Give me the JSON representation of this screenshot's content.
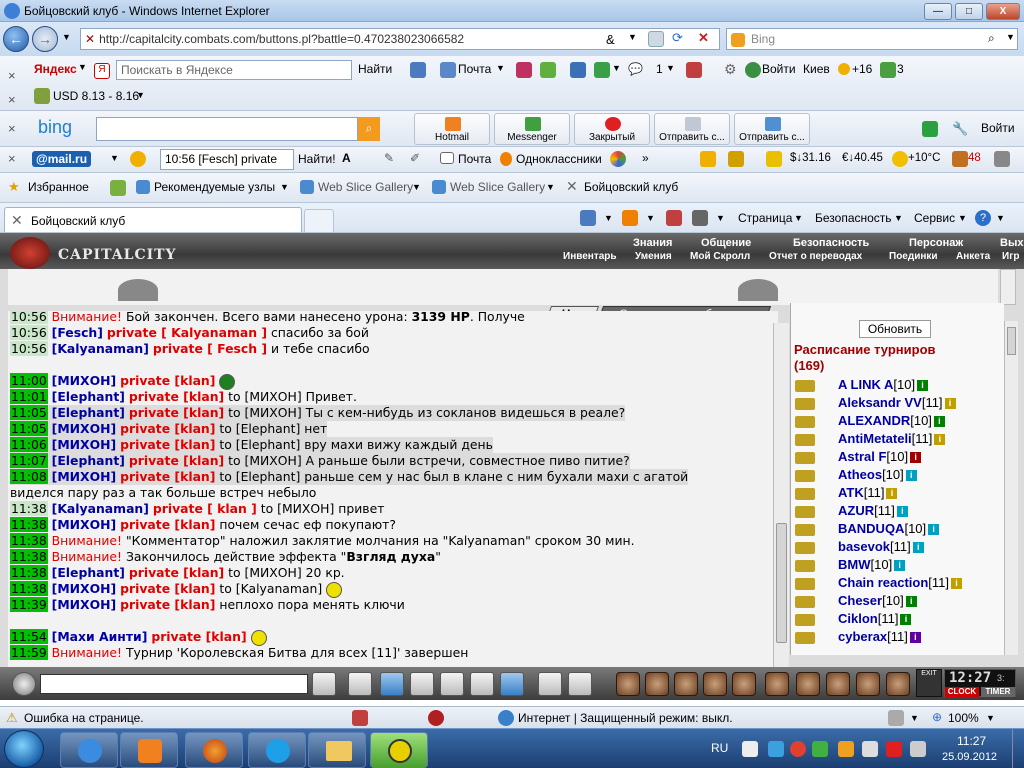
{
  "window": {
    "title": "Бойцовский клуб - Windows Internet Explorer",
    "min": "—",
    "max": "□",
    "close": "X"
  },
  "address": {
    "url": "http://capitalcity.combats.com/buttons.pl?battle=0.470238023066582",
    "search_placeholder": "Bing"
  },
  "yandex": {
    "brand": "Яндекс",
    "search_placeholder": "Поискать в Яндексе",
    "find": "Найти",
    "mail": "Почта",
    "count1": "1",
    "login": "Войти",
    "city": "Киев",
    "temp": "+16",
    "count3": "3",
    "usd": "USD 8.13 - 8.16"
  },
  "bing": {
    "brand": "bing",
    "buttons": [
      "Hotmail",
      "Messenger",
      "Закрытый",
      "Отправить с...",
      "Отправить с..."
    ],
    "login": "Войти"
  },
  "mailru": {
    "brand": "@mail.ru",
    "dropdown": "10:56 [Fesch] private",
    "find": "Найти!",
    "mail": "Почта",
    "ok": "Одноклассники",
    "dollar": "$↓31.16",
    "euro": "€↓40.45",
    "weather": "+10°C",
    "count": "48"
  },
  "favorites": {
    "label": "Избранное",
    "items": [
      "Рекомендуемые узлы",
      "Web Slice Gallery",
      "Web Slice Gallery",
      "Бойцовский клуб"
    ]
  },
  "tab": {
    "label": "Бойцовский клуб"
  },
  "cmd": {
    "page": "Страница",
    "safety": "Безопасность",
    "service": "Сервис"
  },
  "game": {
    "logo": "CAPITALCITY",
    "menu1": [
      "Знания",
      "Общение",
      "Безопасность",
      "Персонаж",
      "Вых"
    ],
    "menu2": [
      "Инвентарь",
      "Умения",
      "Мой Скролл",
      "Отчет о переводах",
      "Поединки",
      "Анкета",
      "Игр"
    ],
    "tabs": [
      "Чат",
      "Системные сообщения"
    ],
    "refresh": "Обновить",
    "tour_title": "Расписание турниров",
    "tour_count": "(169)",
    "clock": "12:27",
    "clock_suffix": "3:",
    "clock_btn": "CLOCK",
    "timer_btn": "TIMER",
    "exit_btn": "EXIT"
  },
  "chat": [
    {
      "time": "10:56",
      "type": "att",
      "att": "Внимание!",
      "text": " Бой закончен. Всего вами нанесено урона: ",
      "bold": "3139 HP",
      "tail": ". Получе"
    },
    {
      "time": "10:56",
      "type": "pm",
      "nick": "[Fesch]",
      "priv": "private [ Kalyanaman ]",
      "text": " спасибо за бой"
    },
    {
      "time": "10:56",
      "type": "pm",
      "nick": "[Kalyanaman]",
      "priv": "private [ Fesch ]",
      "text": " и тебе спасибо"
    },
    {
      "time": "11:00",
      "type": "pm2",
      "nick": "[МИХОН]",
      "priv": "private [klan]",
      "text": ""
    },
    {
      "time": "11:01",
      "type": "pm2",
      "nick": "[Elephant]",
      "priv": "private [klan]",
      "text": " to [МИХОН] Привет."
    },
    {
      "time": "11:05",
      "type": "pm2",
      "nick": "[Elephant]",
      "priv": "private [klan]",
      "text": " to [МИХОН] Ты с кем-нибудь из сокланов видешься в реале?"
    },
    {
      "time": "11:05",
      "type": "pm2",
      "nick": "[МИХОН]",
      "priv": "private [klan]",
      "text": " to [Elephant] нет"
    },
    {
      "time": "11:06",
      "type": "pm2",
      "nick": "[МИХОН]",
      "priv": "private [klan]",
      "text": " to [Elephant] вру махи вижу каждый день"
    },
    {
      "time": "11:07",
      "type": "pm2",
      "nick": "[Elephant]",
      "priv": "private [klan]",
      "text": " to [МИХОН] А раньше были встречи, совместное пиво питие?"
    },
    {
      "time": "11:08",
      "type": "pm2",
      "nick": "[МИХОН]",
      "priv": "private [klan]",
      "text": " to [Elephant] раньше сем у нас был в клане с ним бухали махи с агатой"
    },
    {
      "time": "",
      "type": "cont",
      "text": "виделся пару раз а так больше встреч небыло"
    },
    {
      "time": "11:38",
      "type": "pm",
      "nick": "[Kalyanaman]",
      "priv": "private [ klan ]",
      "text": " to [МИХОН] привет"
    },
    {
      "time": "11:38",
      "type": "pm2",
      "nick": "[МИХОН]",
      "priv": "private [klan]",
      "text": " почем сечас еф покупают?"
    },
    {
      "time": "11:38",
      "type": "att2",
      "att": "Внимание!",
      "text": " \"Комментатор\" наложил заклятие молчания на \"Kalyanaman\" сроком 30 мин."
    },
    {
      "time": "11:38",
      "type": "att2",
      "att": "Внимание!",
      "text": " Закончилось действие эффекта \"",
      "bold": "Взгляд духа",
      "tail": "\""
    },
    {
      "time": "11:38",
      "type": "pm2",
      "nick": "[Elephant]",
      "priv": "private [klan]",
      "text": " to [МИХОН] 20 кр."
    },
    {
      "time": "11:38",
      "type": "pm2",
      "nick": "[МИХОН]",
      "priv": "private [klan]",
      "text": " to [Kalyanaman]"
    },
    {
      "time": "11:39",
      "type": "pm2",
      "nick": "[МИХОН]",
      "priv": "private [klan]",
      "text": " неплохо пора менять ключи"
    },
    {
      "time": "11:54",
      "type": "pm2",
      "nick": "[Махи Аинти]",
      "priv": "private [klan]",
      "text": ""
    },
    {
      "time": "11:59",
      "type": "att2",
      "att": "Внимание!",
      "text": " Турнир 'Королевская Битва для всех [11]' завершен"
    }
  ],
  "tournament": [
    {
      "name": "A LINK A",
      "lvl": "[10]",
      "info": "#008000"
    },
    {
      "name": "Aleksandr VV",
      "lvl": "[11]",
      "info": "#c0a000"
    },
    {
      "name": "ALEXANDR",
      "lvl": "[10]",
      "info": "#008000"
    },
    {
      "name": "AntiMetateli",
      "lvl": "[11]",
      "info": "#c0a000"
    },
    {
      "name": "Astral F",
      "lvl": "[10]",
      "info": "#a00000"
    },
    {
      "name": "Atheos",
      "lvl": "[10]",
      "info": "#00a0c0"
    },
    {
      "name": "ATK",
      "lvl": "[11]",
      "info": "#c0a000"
    },
    {
      "name": "AZUR",
      "lvl": "[11]",
      "info": "#00a0c0"
    },
    {
      "name": "BANDUQA",
      "lvl": "[10]",
      "info": "#00a0c0"
    },
    {
      "name": "basevok",
      "lvl": "[11]",
      "info": "#00a0c0"
    },
    {
      "name": "BMW",
      "lvl": "[10]",
      "info": "#00a0c0"
    },
    {
      "name": "Chain reaction",
      "lvl": "[11]",
      "info": "#c0a000"
    },
    {
      "name": "Cheser",
      "lvl": "[10]",
      "info": "#008000"
    },
    {
      "name": "Ciklon",
      "lvl": "[11]",
      "info": "#008000"
    },
    {
      "name": "cyberax",
      "lvl": "[11]",
      "info": "#6000a0"
    }
  ],
  "status": {
    "error": "Ошибка на странице.",
    "zone": "Интернет | Защищенный режим: выкл.",
    "zoom": "100%"
  },
  "taskbar": {
    "lang": "RU",
    "time": "11:27",
    "date": "25.09.2012"
  }
}
